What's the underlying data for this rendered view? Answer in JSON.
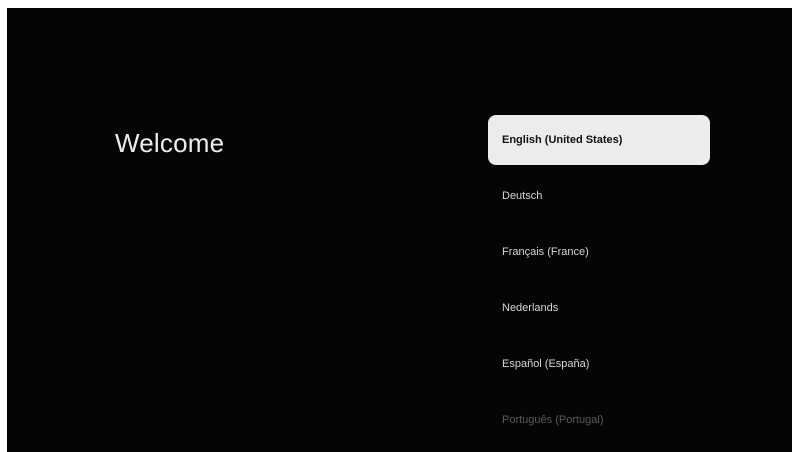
{
  "welcome": {
    "title": "Welcome"
  },
  "languages": [
    {
      "label": "English (United States)",
      "state": "selected"
    },
    {
      "label": "Deutsch",
      "state": "normal"
    },
    {
      "label": "Français (France)",
      "state": "normal"
    },
    {
      "label": "Nederlands",
      "state": "normal"
    },
    {
      "label": "Español (España)",
      "state": "normal"
    },
    {
      "label": "Português (Portugal)",
      "state": "faded"
    }
  ],
  "colors": {
    "background": "#050505",
    "text": "#ececec",
    "selected_bg": "#ececec",
    "selected_text": "#111111",
    "faded_text": "#5a5a5a"
  }
}
